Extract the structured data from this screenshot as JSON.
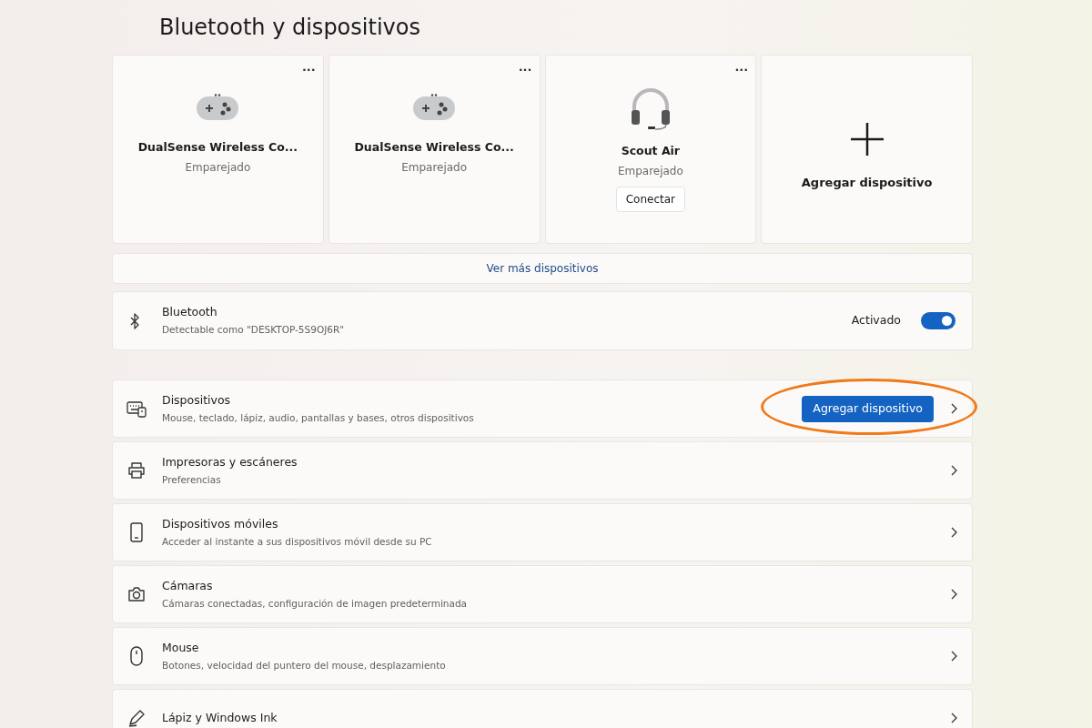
{
  "page_title": "Bluetooth y dispositivos",
  "device_cards": [
    {
      "kind": "gamepad",
      "name": "DualSense Wireless Co...",
      "status": "Emparejado",
      "menu": "..."
    },
    {
      "kind": "gamepad",
      "name": "DualSense Wireless Co...",
      "status": "Emparejado",
      "menu": "..."
    },
    {
      "kind": "headset",
      "name": "Scout Air",
      "status": "Emparejado",
      "menu": "...",
      "action": "Conectar"
    },
    {
      "kind": "add",
      "name": "Agregar dispositivo"
    }
  ],
  "more_devices_link": "Ver más dispositivos",
  "bluetooth": {
    "title": "Bluetooth",
    "subtitle": "Detectable como \"DESKTOP-5S9OJ6R\"",
    "state_label": "Activado",
    "on": true
  },
  "settings_rows": [
    {
      "kind": "keyboard",
      "title": "Dispositivos",
      "subtitle": "Mouse, teclado, lápiz, audio, pantallas y bases, otros dispositivos",
      "button": "Agregar dispositivo",
      "highlighted": true
    },
    {
      "kind": "printer",
      "title": "Impresoras y escáneres",
      "subtitle": "Preferencias"
    },
    {
      "kind": "phone",
      "title": "Dispositivos móviles",
      "subtitle": "Acceder al instante a sus dispositivos móvil desde su PC"
    },
    {
      "kind": "camera",
      "title": "Cámaras",
      "subtitle": "Cámaras conectadas, configuración de imagen predeterminada"
    },
    {
      "kind": "mouse",
      "title": "Mouse",
      "subtitle": "Botones, velocidad del puntero del mouse, desplazamiento"
    },
    {
      "kind": "pen",
      "title": "Lápiz y Windows Ink"
    }
  ]
}
